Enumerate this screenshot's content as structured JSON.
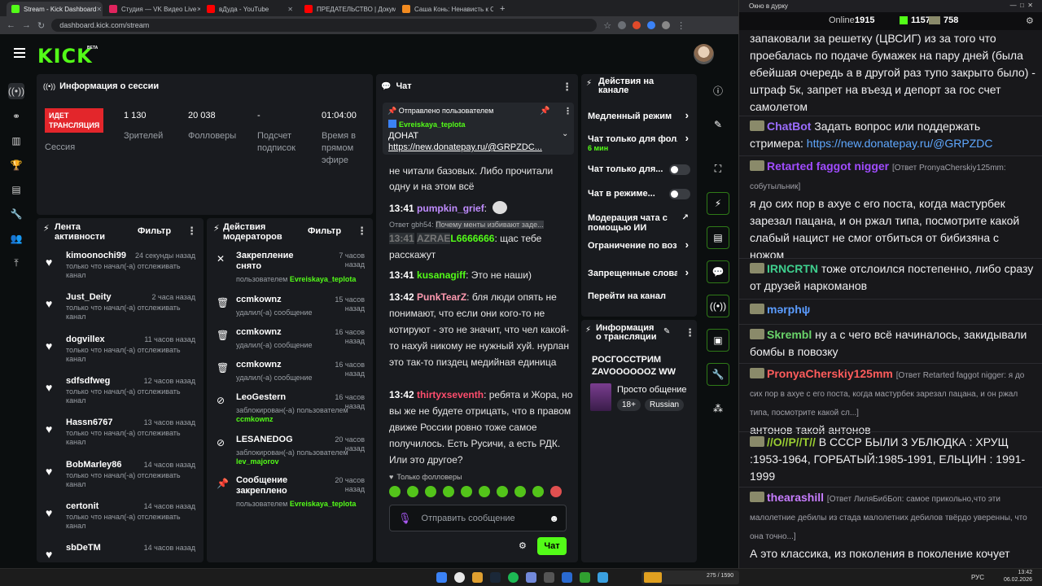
{
  "browser": {
    "tabs": [
      {
        "label": "Stream - Kick Dashboard",
        "color": "#53fc18",
        "active": true
      },
      {
        "label": "Студия — VK Видео Live",
        "color": "#e0245e",
        "active": false
      },
      {
        "label": "вДуда - YouTube",
        "color": "#ff0000",
        "active": false
      },
      {
        "label": "ПРЕДАТЕЛЬСТВО | Докумен...",
        "color": "#ff0000",
        "active": false
      },
      {
        "label": "Саша Конь: Ненависть к Стас...",
        "color": "#f28b20",
        "active": false
      }
    ],
    "url": "dashboard.kick.com/stream"
  },
  "kick": {
    "logo": "KICK",
    "beta": "BETA",
    "session": {
      "title": "Информация о сессии",
      "live_badge": "ИДЕТ ТРАНСЛЯЦИЯ",
      "session_label": "Сессия",
      "stats": [
        {
          "value": "1 130",
          "label": "Зрителей"
        },
        {
          "value": "20 038",
          "label": "Фолловеры"
        },
        {
          "value": "-",
          "label": "Подсчет подписок"
        },
        {
          "value": "01:04:00",
          "label": "Время в прямом эфире"
        }
      ]
    },
    "activity": {
      "title": "Лента активности",
      "filter": "Фильтр",
      "items": [
        {
          "name": "kimoonochi99",
          "time": "24 секунды назад",
          "desc": "только что начал(-а) отслеживать канал"
        },
        {
          "name": "Just_Deity",
          "time": "2 часа назад",
          "desc": "только что начал(-а) отслеживать канал"
        },
        {
          "name": "dogvillex",
          "time": "11 часов назад",
          "desc": "только что начал(-а) отслеживать канал"
        },
        {
          "name": "sdfsdfweg",
          "time": "12 часов назад",
          "desc": "только что начал(-а) отслеживать канал"
        },
        {
          "name": "Hassn6767",
          "time": "13 часов назад",
          "desc": "только что начал(-а) отслеживать канал"
        },
        {
          "name": "BobMarley86",
          "time": "14 часов назад",
          "desc": "только что начал(-а) отслеживать канал"
        },
        {
          "name": "certonit",
          "time": "14 часов назад",
          "desc": "только что начал(-а) отслеживать канал"
        },
        {
          "name": "sbDeTM",
          "time": "14 часов назад",
          "desc": ""
        }
      ]
    },
    "modactions": {
      "title": "Действия модераторов",
      "filter": "Фильтр",
      "items": [
        {
          "icon": "unpin-icon",
          "glyph": "✕",
          "title": "Закрепление снято",
          "time": "7 часов назад",
          "desc": "пользователем",
          "user": "Evreiskaya_teplota"
        },
        {
          "icon": "trash-icon",
          "glyph": "🗑",
          "title": "ccmkownz",
          "time": "15 часов назад",
          "desc": "удалил(-а) сообщение",
          "user": ""
        },
        {
          "icon": "trash-icon",
          "glyph": "🗑",
          "title": "ccmkownz",
          "time": "16 часов назад",
          "desc": "удалил(-а) сообщение",
          "user": ""
        },
        {
          "icon": "trash-icon",
          "glyph": "🗑",
          "title": "ccmkownz",
          "time": "16 часов назад",
          "desc": "удалил(-а) сообщение",
          "user": ""
        },
        {
          "icon": "ban-icon",
          "glyph": "⊘",
          "title": "LeoGestern",
          "time": "16 часов назад",
          "desc": "заблокирован(-а) пользователем",
          "user": "ccmkownz"
        },
        {
          "icon": "ban-icon",
          "glyph": "⊘",
          "title": "LESANEDOG",
          "time": "20 часов назад",
          "desc": "заблокирован(-а) пользователем",
          "user": "lev_majorov"
        },
        {
          "icon": "pin-icon",
          "glyph": "📌",
          "title": "Сообщение закреплено",
          "time": "20 часов назад",
          "desc": "пользователем",
          "user": "Evreiskaya_teplota"
        }
      ]
    },
    "chat": {
      "title": "Чат",
      "pinned_header": "Отправлено пользователем",
      "pinned_user": "Evreiskaya_teplota",
      "pinned_text": "ДОНАТ",
      "pinned_link": "https://new.donatepay.ru/@GRPZDC...",
      "partial": "не читали базовых. Либо прочитали одну и на этом всё",
      "messages": [
        {
          "time": "13:41",
          "user": "pumpkin_grief",
          "color": "#c08cff",
          "text": ""
        },
        {
          "time": "13:41",
          "user": "kusanagiff",
          "color": "#53fc18",
          "text": "Это не наши)"
        },
        {
          "time": "13:42",
          "user": "PunkTearZ",
          "color": "#ff9ab0",
          "text": "бля люди опять не понимают, что если они кого-то не котируют - это не значит, что чел какой-то нахуй никому не нужный хуй. нурлан это так-то пиздец медийная единица"
        },
        {
          "time": "13:42",
          "user": "thirtyxseventh",
          "color": "#ff4d6d",
          "text": "ребята и Жора, но вы же не будете отрицать, что в правом движе России ровно тоже самое получилось. Есть Русичи, а есть РДК. Или это другое?"
        }
      ],
      "reply": {
        "label": "Ответ gbh54:",
        "quoted": "Почему менты избивают заде...",
        "time": "13:41",
        "user1": "AZRAE",
        "user2": "L6666666",
        "text": "щас тебе расскажут"
      },
      "followers_only": "Только фолловеры",
      "input_placeholder": "Отправить сообщение",
      "send": "Чат"
    },
    "actions": {
      "title": "Действия на канале",
      "items": [
        {
          "label": "Медленный режим",
          "sub": "",
          "type": "chevron"
        },
        {
          "label": "Чат только для фолл",
          "sub": "6 мин",
          "type": "chevron"
        },
        {
          "label": "Чат только для...",
          "sub": "",
          "type": "toggle"
        },
        {
          "label": "Чат в режиме...",
          "sub": "",
          "type": "toggle"
        },
        {
          "label": "Модерация чата с помощью ИИ",
          "sub": "",
          "type": "external"
        },
        {
          "label": "Ограничение по возр",
          "sub": "",
          "type": "chevron"
        },
        {
          "label": "Запрещенные слова",
          "sub": "",
          "type": "chevron"
        },
        {
          "label": "Перейти на канал",
          "sub": "",
          "type": "none"
        }
      ]
    },
    "stream_info": {
      "title": "Информация о трансляции",
      "stream_title": "РОСГОССТРИМ ZAVOOOOOOZ WW",
      "category": "Просто общение",
      "tags": [
        "18+",
        "Russian"
      ]
    }
  },
  "popout": {
    "window_title": "Окно в дурку",
    "online_label": "Online:",
    "online": "1915",
    "count1": "1157",
    "count2": "758",
    "messages": [
      {
        "user": "",
        "color": "#efeff1",
        "reply": "",
        "text": "запаковали за решетку (ЦВСИГ) из за того что проебалась по подаче бумажек на пару дней (была ебейшая очередь а в другой раз тупо закрыто было) - штраф 5к, запрет на въезд и депорт за гос счет самолетом"
      },
      {
        "user": "ChatBot",
        "color": "#9b6cff",
        "reply": "",
        "text": "Задать вопрос или поддержать стримера:",
        "link": "https://new.donatepay.ru/@GRPZDC"
      },
      {
        "user": "Retarted faggot nigger",
        "color": "#a04cff",
        "reply": "[Ответ PronyaCherskiy125mm: собутыльник]",
        "text": "я до сих пор в ахуе с его поста, когда мастурбек зарезал пацана, и он ржал типа, посмотрите какой слабый нацист не смог отбиться от бибизяна с ножом"
      },
      {
        "user": "IRNCRTN",
        "color": "#3fcf8e",
        "reply": "",
        "text": "тоже отслоился постепенно, либо сразу от друзей наркоманов"
      },
      {
        "user": "mərphψ",
        "color": "#5b9cff",
        "reply": "",
        "text": ""
      },
      {
        "user": "Skrembl",
        "color": "#6ad36a",
        "reply": "",
        "text": "ну а с чего всё начиналось, закидывали бомбы в повозку"
      },
      {
        "user": "PronyaCherskiy125mm",
        "color": "#ff5c5c",
        "reply": "[Ответ Retarted faggot nigger: я до сих пор в ахуе с его поста, когда мастурбек зарезал пацана, и он ржал типа, посмотрите какой сл...]",
        "text": "антонов такой антонов"
      },
      {
        "user": "//О//Р//Т//",
        "color": "#9acd32",
        "reply": "",
        "text": "В СССР БЫЛИ 3 УБЛЮДКА : ХРУЩ :1953-1964, ГОРБАТЫЙ:1985-1991, ЕЛЬЦИН : 1991-1999"
      },
      {
        "user": "thearashill",
        "color": "#c77dff",
        "reply": "[Ответ ЛиляБибБоп: самое прикольно,что эти малолетние дебилы из стада малолетних дебилов твёрдо уверенны, что она точно...]",
        "text": "А это классика, из поколения в поколение кочует"
      }
    ]
  },
  "taskbar": {
    "time": "13:42",
    "date": "06.02.2026",
    "lang": "РУС",
    "media": "275 / 1590"
  }
}
